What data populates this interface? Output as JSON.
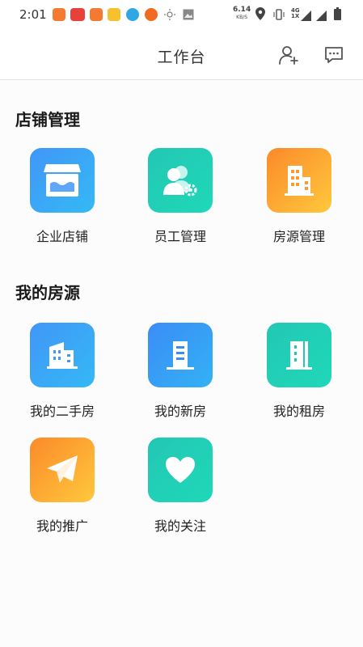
{
  "status_bar": {
    "time": "2:01",
    "net_speed": "6.14",
    "net_speed_unit": "KB/S",
    "network": "4G",
    "sim": "1X"
  },
  "header": {
    "title": "工作台",
    "icons": [
      "add-user-icon",
      "message-icon"
    ]
  },
  "sections": {
    "store": {
      "title": "店铺管理",
      "items": [
        {
          "label": "企业店铺",
          "icon": "store-icon"
        },
        {
          "label": "员工管理",
          "icon": "staff-icon"
        },
        {
          "label": "房源管理",
          "icon": "building-icon"
        }
      ]
    },
    "mine": {
      "title": "我的房源",
      "items": [
        {
          "label": "我的二手房",
          "icon": "secondhand-building-icon"
        },
        {
          "label": "我的新房",
          "icon": "new-building-icon"
        },
        {
          "label": "我的租房",
          "icon": "rental-building-icon"
        },
        {
          "label": "我的推广",
          "icon": "paper-plane-icon"
        },
        {
          "label": "我的关注",
          "icon": "heart-icon"
        }
      ]
    }
  },
  "colors": {
    "blue": "#4196f7",
    "teal": "#23c7b4",
    "orange": "#fb8a2a"
  }
}
